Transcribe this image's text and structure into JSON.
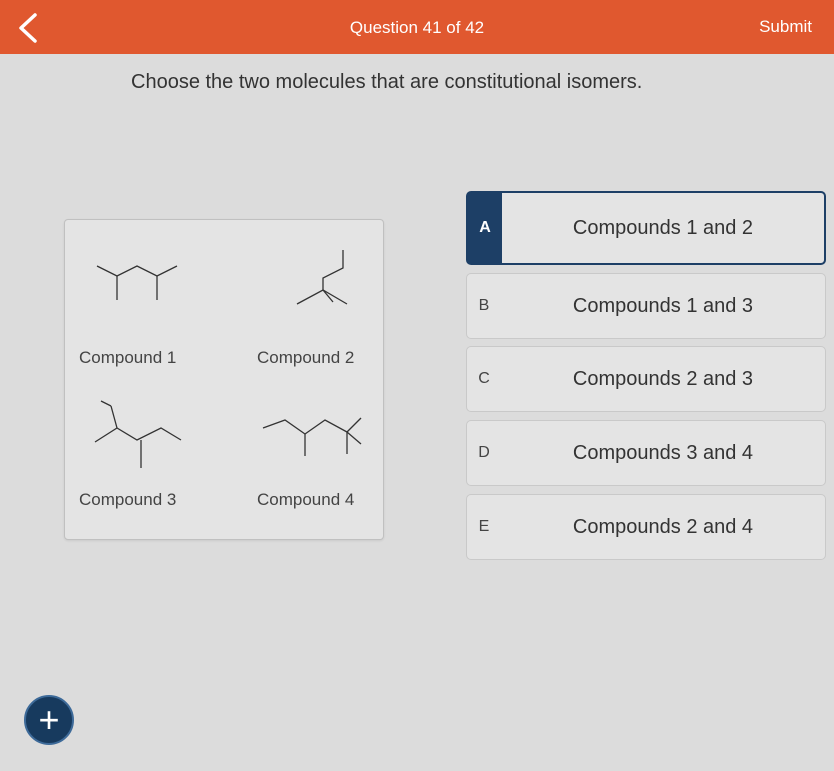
{
  "header": {
    "title": "Question 41 of 42",
    "submit_label": "Submit",
    "back_icon": "chevron-left-icon"
  },
  "question": {
    "prompt": "Choose the two molecules that are constitutional isomers."
  },
  "compounds": [
    {
      "label": "Compound 1"
    },
    {
      "label": "Compound 2"
    },
    {
      "label": "Compound 3"
    },
    {
      "label": "Compound 4"
    }
  ],
  "options": [
    {
      "letter": "A",
      "text": "Compounds 1 and 2",
      "selected": true
    },
    {
      "letter": "B",
      "text": "Compounds 1 and 3",
      "selected": false
    },
    {
      "letter": "C",
      "text": "Compounds 2 and 3",
      "selected": false
    },
    {
      "letter": "D",
      "text": "Compounds 3 and 4",
      "selected": false
    },
    {
      "letter": "E",
      "text": "Compounds 2 and 4",
      "selected": false
    }
  ],
  "fab": {
    "icon": "plus-icon",
    "label": "+"
  },
  "colors": {
    "header": "#e0582f",
    "selected": "#1d3f66"
  }
}
